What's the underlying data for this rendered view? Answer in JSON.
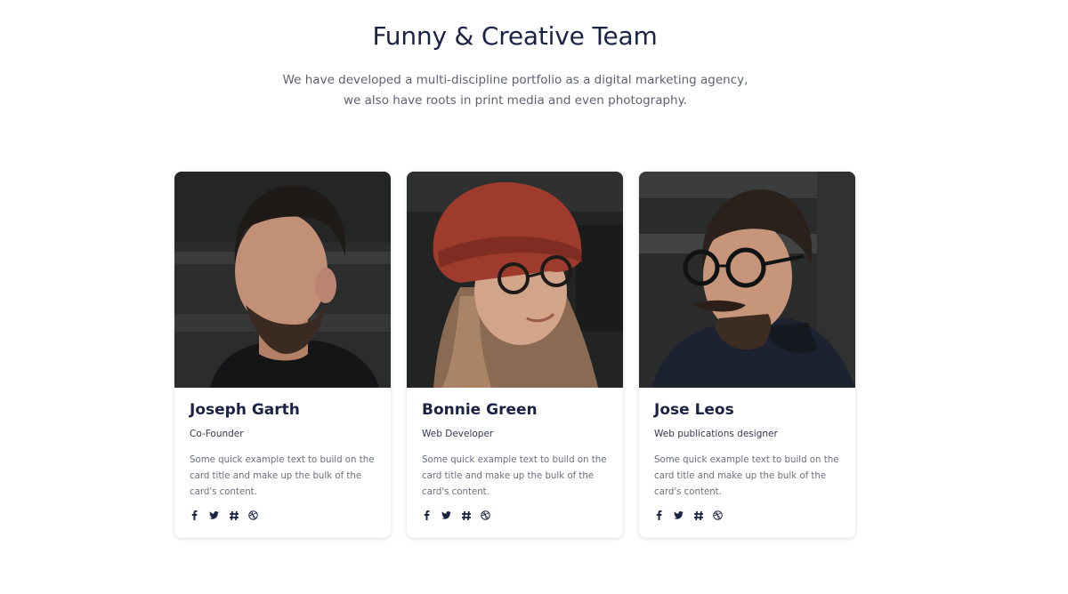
{
  "section": {
    "title": "Funny & Creative Team",
    "lead": "We have developed a multi-discipline portfolio as a digital marketing agency, we also have roots in print media and even photography."
  },
  "members": [
    {
      "name": "Joseph Garth",
      "role": "Co-Founder",
      "description": "Some quick example text to build on the card title and make up the bulk of the card's content.",
      "photo": "man-with-dark-hair-and-beard-portrait"
    },
    {
      "name": "Bonnie Green",
      "role": "Web Developer",
      "description": "Some quick example text to build on the card title and make up the bulk of the card's content.",
      "photo": "woman-with-red-beanie-and-glasses-portrait"
    },
    {
      "name": "Jose Leos",
      "role": "Web publications designer",
      "description": "Some quick example text to build on the card title and make up the bulk of the card's content.",
      "photo": "man-with-glasses-and-mustache-portrait"
    }
  ],
  "social_icons": [
    "facebook-icon",
    "twitter-icon",
    "slack-icon",
    "dribbble-icon"
  ],
  "colors": {
    "heading": "#1b2345",
    "text": "#6a6f7e",
    "icon": "#1b2345"
  }
}
